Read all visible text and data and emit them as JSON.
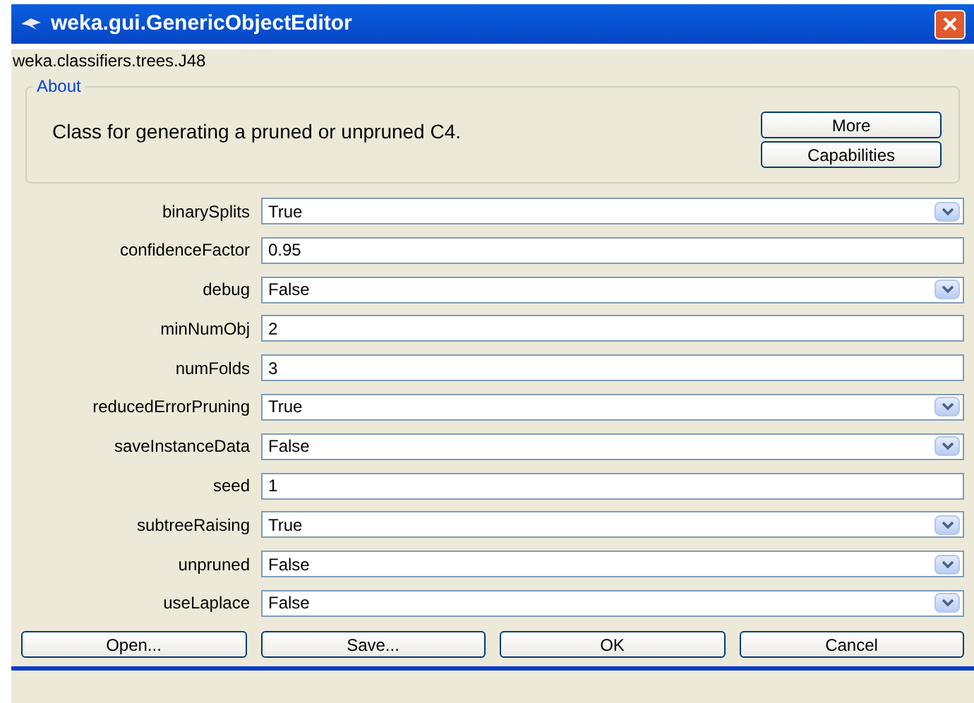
{
  "window": {
    "title": "weka.gui.GenericObjectEditor"
  },
  "class_name": "weka.classifiers.trees.J48",
  "about": {
    "legend": "About",
    "text": "Class for generating a pruned or unpruned C4.",
    "buttons": [
      "More",
      "Capabilities"
    ]
  },
  "properties": [
    {
      "label": "binarySplits",
      "kind": "dropdown",
      "value": "True"
    },
    {
      "label": "confidenceFactor",
      "kind": "text",
      "value": "0.95"
    },
    {
      "label": "debug",
      "kind": "dropdown",
      "value": "False"
    },
    {
      "label": "minNumObj",
      "kind": "text",
      "value": "2"
    },
    {
      "label": "numFolds",
      "kind": "text",
      "value": "3"
    },
    {
      "label": "reducedErrorPruning",
      "kind": "dropdown",
      "value": "True"
    },
    {
      "label": "saveInstanceData",
      "kind": "dropdown",
      "value": "False"
    },
    {
      "label": "seed",
      "kind": "text",
      "value": "1"
    },
    {
      "label": "subtreeRaising",
      "kind": "dropdown",
      "value": "True"
    },
    {
      "label": "unpruned",
      "kind": "dropdown",
      "value": "False"
    },
    {
      "label": "useLaplace",
      "kind": "dropdown",
      "value": "False"
    }
  ],
  "buttons": [
    "Open...",
    "Save...",
    "OK",
    "Cancel"
  ]
}
